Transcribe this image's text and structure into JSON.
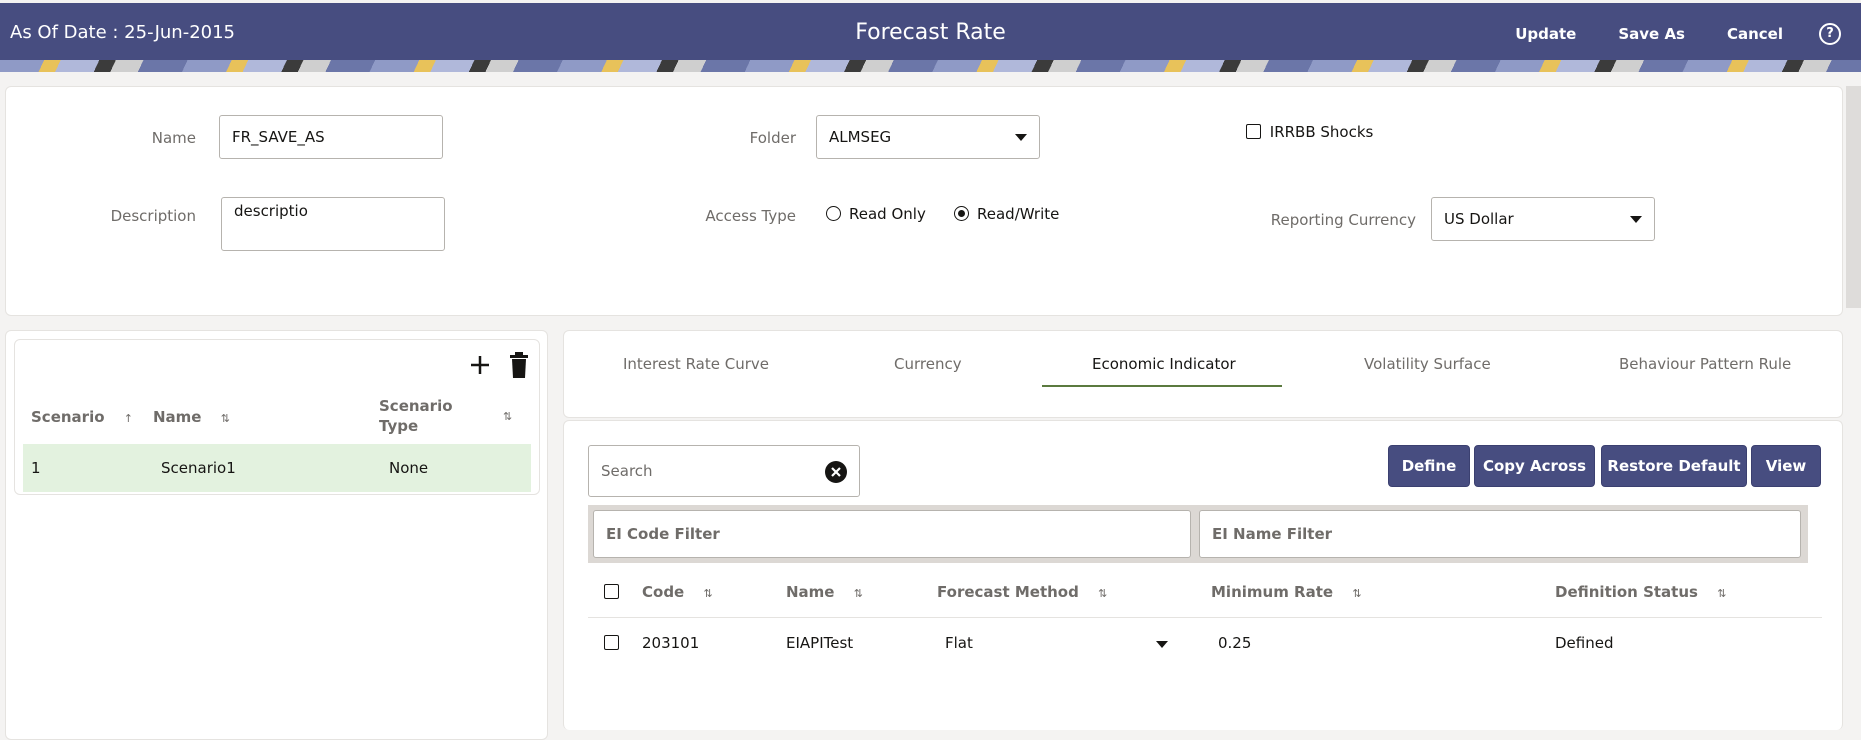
{
  "header": {
    "as_of_date": "As Of Date : 25-Jun-2015",
    "title": "Forecast Rate",
    "actions": [
      "Update",
      "Save As",
      "Cancel"
    ],
    "help_icon": "?"
  },
  "form": {
    "name_label": "Name",
    "name_value": "FR_SAVE_AS",
    "description_label": "Description",
    "description_value": "descriptio",
    "folder_label": "Folder",
    "folder_value": "ALMSEG",
    "access_type_label": "Access Type",
    "access_options": [
      {
        "label": "Read Only",
        "selected": false
      },
      {
        "label": "Read/Write",
        "selected": true
      }
    ],
    "irrbb_label": "IRRBB Shocks",
    "irrbb_checked": false,
    "reporting_currency_label": "Reporting Currency",
    "reporting_currency_value": "US Dollar"
  },
  "scenarios": {
    "columns": [
      "Scenario",
      "Name",
      "Scenario Type"
    ],
    "scenario_type_header_lines": [
      "Scenario",
      "Type"
    ],
    "sort_asc": "↑",
    "sort_both": "⇅",
    "rows": [
      {
        "scenario": "1",
        "name": "Scenario1",
        "type": "None",
        "selected": true
      }
    ]
  },
  "tabs": [
    {
      "label": "Interest Rate Curve",
      "active": false
    },
    {
      "label": "Currency",
      "active": false
    },
    {
      "label": "Economic Indicator",
      "active": true
    },
    {
      "label": "Volatility Surface",
      "active": false
    },
    {
      "label": "Behaviour Pattern Rule",
      "active": false
    }
  ],
  "content": {
    "search_placeholder": "Search",
    "buttons": [
      "Define",
      "Copy Across",
      "Restore Default",
      "View"
    ],
    "filters": {
      "code_placeholder": "EI Code Filter",
      "name_placeholder": "EI Name Filter"
    },
    "columns": [
      "Code",
      "Name",
      "Forecast Method",
      "Minimum Rate",
      "Definition Status"
    ],
    "rows": [
      {
        "code": "203101",
        "name": "EIAPITest",
        "forecast_method": "Flat",
        "minimum_rate": "0.25",
        "definition_status": "Defined",
        "checked": false
      }
    ]
  },
  "colors": {
    "brand": "#474d80",
    "selected_row": "#e3f2df",
    "active_tab_underline": "#5b7a3f"
  }
}
